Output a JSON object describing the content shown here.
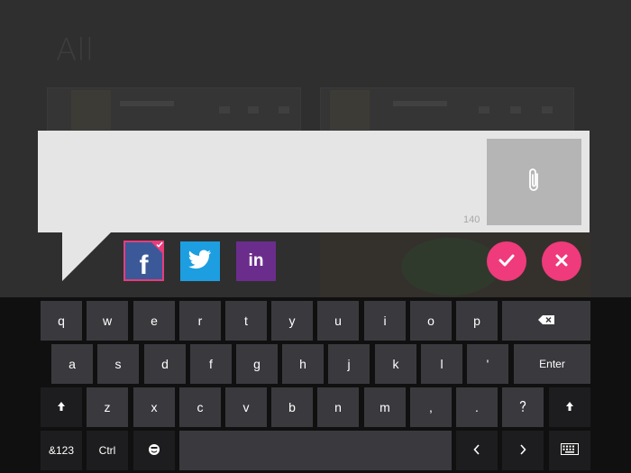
{
  "background": {
    "title": "All"
  },
  "composer": {
    "text_value": "",
    "char_counter": "140"
  },
  "icons": {
    "attach": "paperclip-icon",
    "facebook": "facebook-icon",
    "twitter": "twitter-icon",
    "linkedin": "linkedin-icon",
    "ok": "checkmark-icon",
    "cancel": "close-icon"
  },
  "social": {
    "facebook_letter": "f",
    "linkedin_letter": "in",
    "selected": "facebook"
  },
  "colors": {
    "accent_pink": "#ef3a7b",
    "facebook_blue": "#3b5998",
    "twitter_blue": "#1d9ee0",
    "linkedin_purple": "#6b2d8c",
    "composer_bg": "#e5e5e5"
  },
  "keyboard": {
    "row1": [
      "q",
      "w",
      "e",
      "r",
      "t",
      "y",
      "u",
      "i",
      "o",
      "p"
    ],
    "row2": [
      "a",
      "s",
      "d",
      "f",
      "g",
      "h",
      "j",
      "k",
      "l",
      "'"
    ],
    "row2_enter": "Enter",
    "row3": [
      "z",
      "x",
      "c",
      "v",
      "b",
      "n",
      "m",
      ",",
      "."
    ],
    "row4": {
      "num": "&123",
      "ctrl": "Ctrl"
    }
  }
}
